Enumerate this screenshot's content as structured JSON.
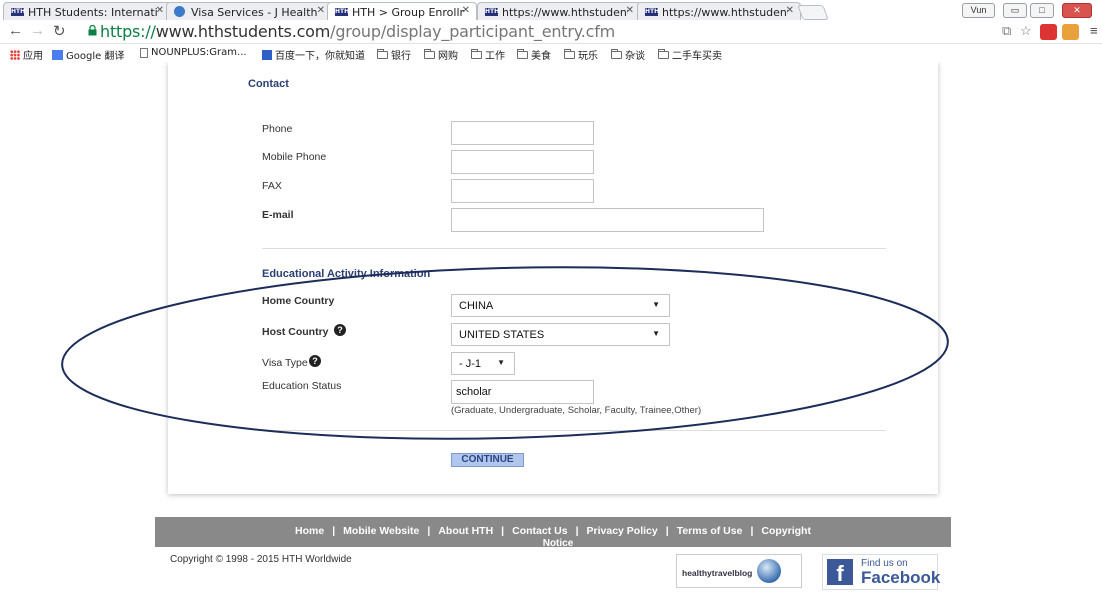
{
  "browser": {
    "tabs": [
      {
        "label": "HTH Students: Internati",
        "favicon": "hth-favicon",
        "active": false
      },
      {
        "label": "Visa Services - J Health",
        "favicon": "globe-favicon",
        "active": false
      },
      {
        "label": "HTH > Group Enrollmen",
        "favicon": "hth-favicon",
        "active": true
      },
      {
        "label": "https://www.hthstudent",
        "favicon": "hth-favicon",
        "active": false
      },
      {
        "label": "https://www.hthstudent",
        "favicon": "hth-favicon",
        "active": false
      }
    ],
    "user_badge": "Vun",
    "url": {
      "scheme": "https://",
      "host": "www.hthstudents.com",
      "path": "/group/display_participant_entry.cfm"
    },
    "bookmarks": [
      {
        "label": "应用",
        "icon": "apps-icon"
      },
      {
        "label": "Google 翻译",
        "icon": "google-translate-icon"
      },
      {
        "label": "NOUNPLUS:Gram...",
        "icon": "page-icon"
      },
      {
        "label": "百度一下，你就知道",
        "icon": "baidu-icon"
      },
      {
        "label": "银行",
        "icon": "folder-icon"
      },
      {
        "label": "网购",
        "icon": "folder-icon"
      },
      {
        "label": "工作",
        "icon": "folder-icon"
      },
      {
        "label": "美食",
        "icon": "folder-icon"
      },
      {
        "label": "玩乐",
        "icon": "folder-icon"
      },
      {
        "label": "杂谈",
        "icon": "folder-icon"
      },
      {
        "label": "二手车买卖",
        "icon": "folder-icon"
      }
    ]
  },
  "form": {
    "contact": {
      "title": "Contact",
      "phone_label": "Phone",
      "phone_value": "",
      "mobile_label": "Mobile Phone",
      "mobile_value": "",
      "fax_label": "FAX",
      "fax_value": "",
      "email_label": "E-mail",
      "email_value": ""
    },
    "education": {
      "title": "Educational Activity Information",
      "home_country_label": "Home Country",
      "home_country_value": "CHINA",
      "host_country_label": "Host Country",
      "host_country_value": "UNITED STATES",
      "visa_type_label": "Visa Type",
      "visa_type_value": "- J-1",
      "education_status_label": "Education Status",
      "education_status_value": "scholar",
      "education_status_hint": "(Graduate, Undergraduate, Scholar, Faculty, Trainee,Other)"
    },
    "continue_label": "CONTINUE"
  },
  "footer": {
    "links": [
      "Home",
      "Mobile Website",
      "About HTH",
      "Contact Us",
      "Privacy Policy",
      "Terms of Use",
      "Copyright"
    ],
    "wrap_text": "Notice",
    "copyright": "Copyright © 1998 - 2015 HTH Worldwide",
    "blog_badge": "healthytravelblog",
    "facebook_small": "Find us on",
    "facebook_big": "Facebook"
  },
  "annotation": {
    "shape": "ellipse",
    "color": "#1c2d5a"
  }
}
